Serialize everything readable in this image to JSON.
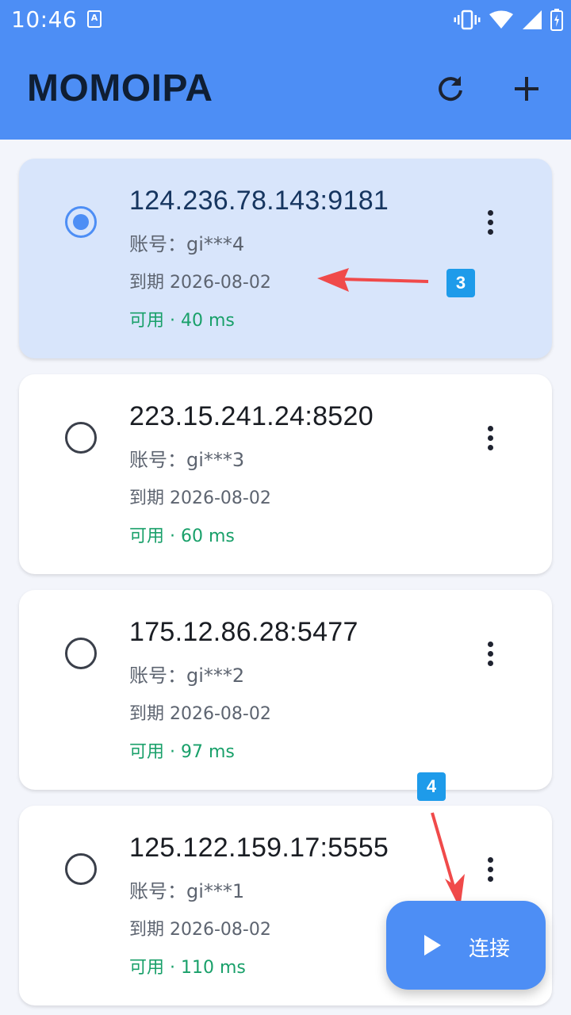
{
  "status_bar": {
    "time": "10:46",
    "app_icon_letter": "A",
    "icons": [
      "vibrate-icon",
      "wifi-icon",
      "signal-icon",
      "battery-icon"
    ]
  },
  "app_bar": {
    "title": "MOMOIPA",
    "actions": [
      "refresh-icon",
      "add-icon"
    ]
  },
  "servers": [
    {
      "address": "124.236.78.143:9181",
      "account": "账号：gi***4",
      "expiry": "到期 2026-08-02",
      "status": "可用 · 40 ms",
      "selected": true
    },
    {
      "address": "223.15.241.24:8520",
      "account": "账号：gi***3",
      "expiry": "到期 2026-08-02",
      "status": "可用 · 60 ms",
      "selected": false
    },
    {
      "address": "175.12.86.28:5477",
      "account": "账号：gi***2",
      "expiry": "到期 2026-08-02",
      "status": "可用 · 97 ms",
      "selected": false
    },
    {
      "address": "125.122.159.17:5555",
      "account": "账号：gi***1",
      "expiry": "到期 2026-08-02",
      "status": "可用 · 110 ms",
      "selected": false
    }
  ],
  "annotations": {
    "marker_3": "3",
    "marker_4": "4"
  },
  "fab": {
    "label": "连接"
  },
  "colors": {
    "primary": "#4d8ef5",
    "selected_card": "#d8e5fb",
    "status_ok": "#19a06a",
    "annotation_arrow": "#f04a4a",
    "annotation_marker": "#1e9bea"
  }
}
